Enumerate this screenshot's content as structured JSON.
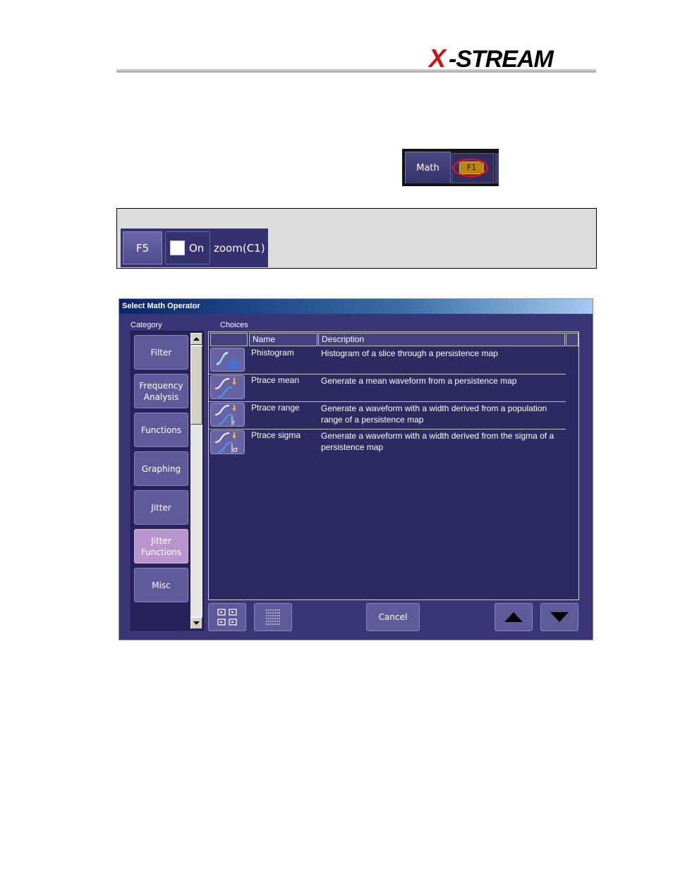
{
  "logo": {
    "text": "X-STREAM"
  },
  "math_snippet": {
    "math_label": "Math",
    "f1_label": "F1"
  },
  "f5_panel": {
    "trace_label": "F5",
    "on_label": "On",
    "source": "zoom(C1)"
  },
  "dialog": {
    "title": "Select Math Operator",
    "category_label": "Category",
    "choices_label": "Choices",
    "categories": [
      {
        "label": "Filter",
        "selected": false
      },
      {
        "label": "Frequency\nAnalysis",
        "selected": false
      },
      {
        "label": "Functions",
        "selected": false
      },
      {
        "label": "Graphing",
        "selected": false
      },
      {
        "label": "Jitter",
        "selected": false
      },
      {
        "label": "Jitter\nFunctions",
        "selected": true
      },
      {
        "label": "Misc",
        "selected": false
      }
    ],
    "columns": {
      "name": "Name",
      "description": "Description"
    },
    "choices": [
      {
        "name": "Phistogram",
        "description": "Histogram of a slice through a persistence map",
        "icon": "histogram-icon"
      },
      {
        "name": "Ptrace mean",
        "description": "Generate a mean waveform from a persistence map",
        "icon": "mean-trace-icon"
      },
      {
        "name": "Ptrace range",
        "description": "Generate a waveform with a width derived from a population range of a persistence map",
        "icon": "range-trace-icon"
      },
      {
        "name": "Ptrace sigma",
        "description": "Generate a waveform with a width derived from the sigma of a persistence map",
        "icon": "sigma-trace-icon"
      }
    ],
    "cancel_label": "Cancel"
  },
  "colors": {
    "dialog_bg": "#3a3576",
    "button": "#5f5b9b",
    "selected_category": "#b895cd",
    "f1_badge": "#b8860b"
  }
}
